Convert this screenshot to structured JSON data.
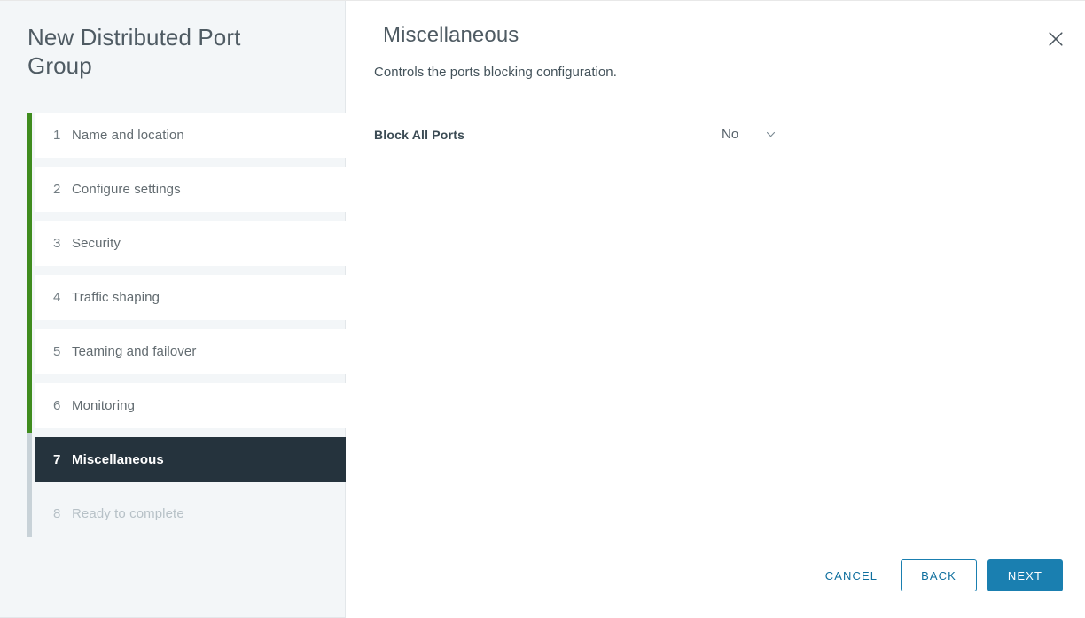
{
  "wizard": {
    "title": "New Distributed Port Group"
  },
  "sidebar": {
    "steps": [
      {
        "num": "1",
        "label": "Name and location",
        "state": "complete"
      },
      {
        "num": "2",
        "label": "Configure settings",
        "state": "complete"
      },
      {
        "num": "3",
        "label": "Security",
        "state": "complete"
      },
      {
        "num": "4",
        "label": "Traffic shaping",
        "state": "complete"
      },
      {
        "num": "5",
        "label": "Teaming and failover",
        "state": "complete"
      },
      {
        "num": "6",
        "label": "Monitoring",
        "state": "complete"
      },
      {
        "num": "7",
        "label": "Miscellaneous",
        "state": "active"
      },
      {
        "num": "8",
        "label": "Ready to complete",
        "state": "disabled"
      }
    ]
  },
  "main": {
    "title": "Miscellaneous",
    "subtitle": "Controls the ports blocking configuration.",
    "close_icon": "close-icon",
    "form": {
      "block_all_ports": {
        "label": "Block All Ports",
        "value": "No",
        "caret_icon": "chevron-down-icon"
      }
    }
  },
  "footer": {
    "cancel_label": "CANCEL",
    "back_label": "BACK",
    "next_label": "NEXT"
  },
  "colors": {
    "accent_blue": "#1a7fb0",
    "progress_green": "#3f8c1e",
    "active_step_bg": "#25333d",
    "sidebar_bg": "#f3f6f8"
  }
}
